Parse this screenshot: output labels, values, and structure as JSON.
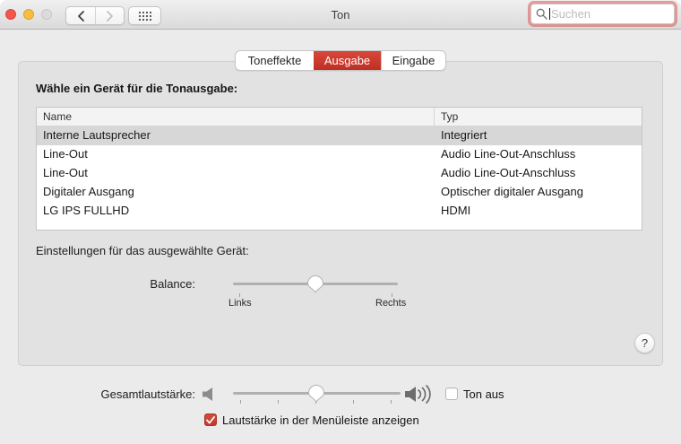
{
  "window": {
    "title": "Ton"
  },
  "toolbar": {
    "search_placeholder": "Suchen",
    "back_icon": "chevron-left",
    "forward_icon": "chevron-right",
    "show_all_icon": "grid-of-dots"
  },
  "tabs": [
    {
      "label": "Toneffekte",
      "selected": false
    },
    {
      "label": "Ausgabe",
      "selected": true
    },
    {
      "label": "Eingabe",
      "selected": false
    }
  ],
  "output_section": {
    "heading": "Wähle ein Gerät für die Tonausgabe:",
    "table": {
      "columns": {
        "name": "Name",
        "typ": "Typ"
      },
      "rows": [
        {
          "name": "Interne Lautsprecher",
          "typ": "Integriert",
          "selected": true
        },
        {
          "name": "Line-Out",
          "typ": "Audio Line-Out-Anschluss",
          "selected": false
        },
        {
          "name": "Line-Out",
          "typ": "Audio Line-Out-Anschluss",
          "selected": false
        },
        {
          "name": "Digitaler Ausgang",
          "typ": "Optischer digitaler Ausgang",
          "selected": false
        },
        {
          "name": "LG IPS FULLHD",
          "typ": "HDMI",
          "selected": false
        }
      ]
    },
    "settings_heading": "Einstellungen für das ausgewählte Gerät:",
    "balance": {
      "label": "Balance:",
      "left_label": "Links",
      "right_label": "Rechts",
      "value_percent": 50
    }
  },
  "help_button": {
    "label": "?"
  },
  "footer": {
    "master_volume_label": "Gesamtlautstärke:",
    "volume_percent": 50,
    "mute_label": "Ton aus",
    "mute_checked": false,
    "menubar_label": "Lautstärke in der Menüleiste anzeigen",
    "menubar_checked": true
  },
  "colors": {
    "accent_red": "#c63529",
    "tab_selected_gradient_top": "#d8473a",
    "tab_selected_gradient_bottom": "#bf2f24",
    "focus_ring": "rgba(219,87,80,0.55)",
    "selected_row": "#d8d7d7",
    "pane_background": "#e3e2e2",
    "window_background": "#ecebeb"
  }
}
